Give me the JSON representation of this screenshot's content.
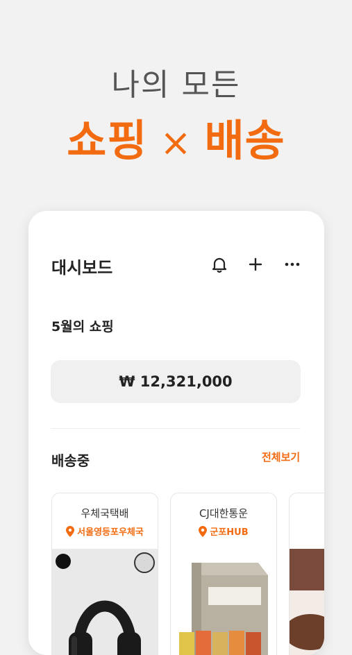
{
  "hero": {
    "line1": "나의 모든",
    "word_shopping": "쇼핑",
    "times": "×",
    "word_delivery": "배송"
  },
  "dashboard": {
    "title": "대시보드",
    "icons": [
      "bell-icon",
      "plus-icon",
      "more-icon"
    ],
    "month_label": "5월의 쇼핑",
    "amount": "₩ 12,321,000"
  },
  "shipping": {
    "title": "배송중",
    "view_all": "전체보기",
    "packages": [
      {
        "courier": "우체국택배",
        "location": "서울영등포우체국"
      },
      {
        "courier": "CJ대한통운",
        "location": "군포HUB"
      }
    ]
  },
  "colors": {
    "accent": "#f26b10",
    "background": "#f2f2f2",
    "card": "#ffffff"
  }
}
